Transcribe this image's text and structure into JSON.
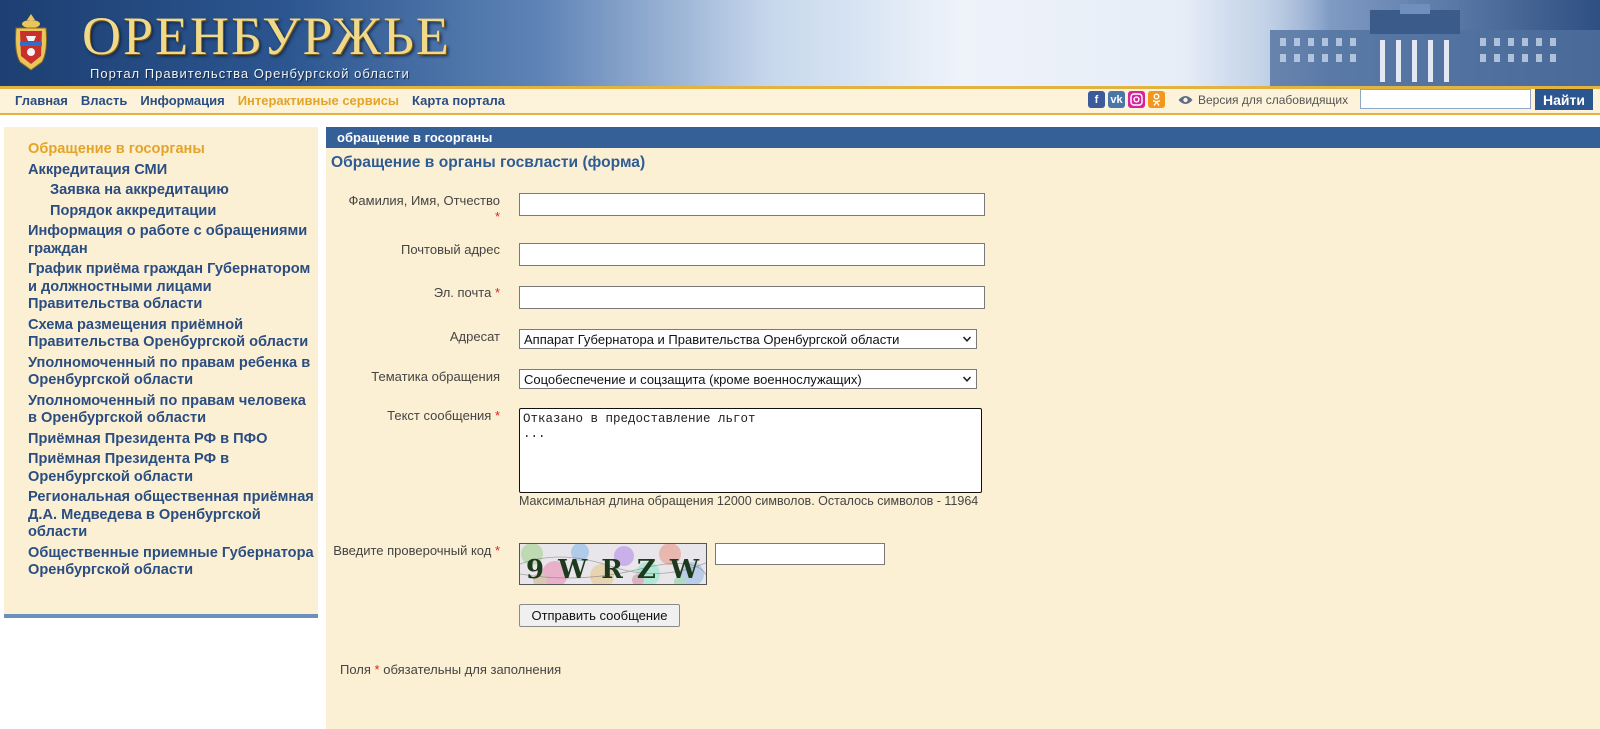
{
  "header": {
    "title": "ОРЕНБУРЖЬЕ",
    "subtitle": "Портал Правительства Оренбургской области"
  },
  "nav": {
    "items": [
      {
        "label": "Главная",
        "active": false
      },
      {
        "label": "Власть",
        "active": false
      },
      {
        "label": "Информация",
        "active": false
      },
      {
        "label": "Интерактивные сервисы",
        "active": true
      },
      {
        "label": "Карта портала",
        "active": false
      }
    ],
    "accessibility_label": "Версия для слабовидящих",
    "search_button": "Найти",
    "search_value": ""
  },
  "social": [
    "facebook-icon",
    "vk-icon",
    "instagram-icon",
    "odnoklassniki-icon"
  ],
  "sidebar": {
    "items": [
      {
        "label": "Обращение в госорганы",
        "active": true,
        "sub": false
      },
      {
        "label": "Аккредитация СМИ",
        "active": false,
        "sub": false
      },
      {
        "label": "Заявка на аккредитацию",
        "active": false,
        "sub": true
      },
      {
        "label": "Порядок аккредитации",
        "active": false,
        "sub": true
      },
      {
        "label": "Информация о работе с обращениями граждан",
        "active": false,
        "sub": false
      },
      {
        "label": "График приёма граждан Губернатором и должностными лицами Правительства области",
        "active": false,
        "sub": false
      },
      {
        "label": "Схема размещения приёмной Правительства Оренбургской области",
        "active": false,
        "sub": false
      },
      {
        "label": "Уполномоченный по правам ребенка в Оренбургской области",
        "active": false,
        "sub": false
      },
      {
        "label": "Уполномоченный по правам человека в Оренбургской области",
        "active": false,
        "sub": false
      },
      {
        "label": "Приёмная Президента РФ в ПФО",
        "active": false,
        "sub": false
      },
      {
        "label": "Приёмная Президента РФ в Оренбургской области",
        "active": false,
        "sub": false
      },
      {
        "label": "Региональная общественная приёмная Д.А. Медведева в Оренбургской области",
        "active": false,
        "sub": false
      },
      {
        "label": "Общественные приемные Губернатора Оренбургской области",
        "active": false,
        "sub": false
      }
    ]
  },
  "main": {
    "section_header": "обращение в госорганы",
    "form_title": "Обращение в органы госвласти (форма)",
    "fields": {
      "fio_label": "Фамилия, Имя, Отчество",
      "fio_value": "",
      "address_label": "Почтовый адрес",
      "address_value": "",
      "email_label": "Эл. почта",
      "email_value": "",
      "recipient_label": "Адресат",
      "recipient_value": "Аппарат Губернатора и Правительства Оренбургской области",
      "topic_label": "Тематика обращения",
      "topic_value": "Соцобеспечение и соцзащита (кроме военнослужащих)",
      "message_label": "Текст сообщения",
      "message_value": "Отказано в предоставление льгот\n...",
      "message_hint": "Максимальная длина обращения 12000 символов. Осталось символов - 11964",
      "captcha_label": "Введите проверочный код",
      "captcha_text": "9WRZW",
      "captcha_value": ""
    },
    "required_mark": "*",
    "submit_label": "Отправить сообщение",
    "footer_note_before": "Поля",
    "footer_note_after": "обязательны для заполнения"
  }
}
